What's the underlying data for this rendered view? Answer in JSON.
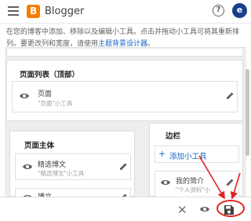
{
  "header": {
    "logo_letter": "B",
    "title": "Blogger",
    "help_symbol": "?",
    "avatar_letter": "e"
  },
  "instructions": {
    "text": "在您的博客中添加、移除以及编辑小工具。点击并拖动小工具可将其重新排列。要更改列和宽度，请使用",
    "link": "主题背景设计器",
    "suffix": "。"
  },
  "sections": {
    "header_list": {
      "title": "页面列表（顶部）",
      "widget": {
        "name": "页面",
        "sub": "\"页面\"小工具"
      }
    },
    "main": {
      "title": "页面主体",
      "widgets": [
        {
          "name": "精选博文",
          "sub": "\"精选博文\"小工具"
        },
        {
          "name": "博文",
          "sub": ""
        }
      ]
    },
    "sidebar": {
      "title": "边栏",
      "add_label": "添加小工具",
      "widgets": [
        {
          "name": "我的简介",
          "sub": "\"个人资料\"小"
        }
      ]
    }
  },
  "bottom_bar": {
    "close_symbol": "✕"
  },
  "colors": {
    "accent": "#1565c0",
    "logo": "#f57d00",
    "avatar": "#1a3e8c",
    "annotation_red": "#e0231f"
  },
  "icons": [
    "hamburger-menu-icon",
    "blogger-logo-icon",
    "help-icon",
    "eye-icon",
    "pencil-icon",
    "plus-icon",
    "close-icon",
    "save-icon"
  ]
}
